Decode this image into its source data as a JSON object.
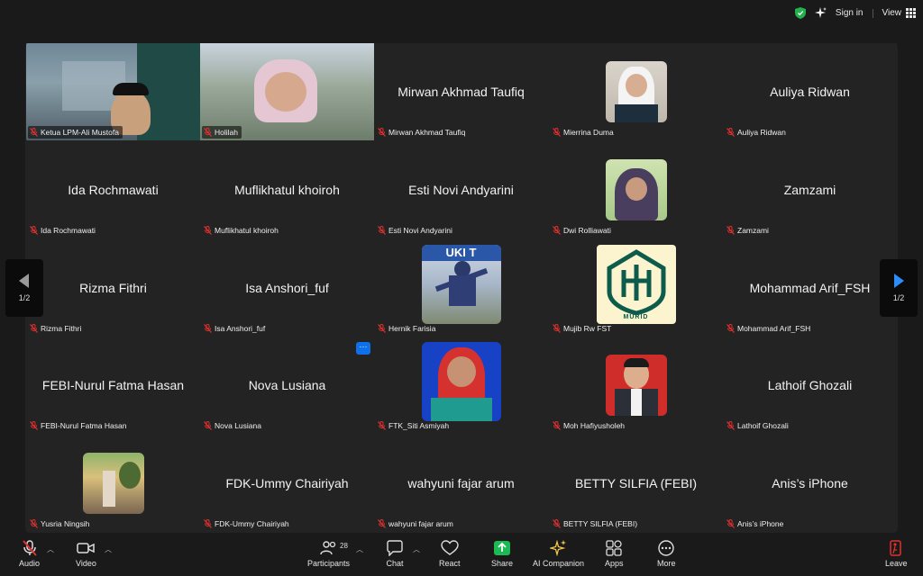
{
  "topbar": {
    "sign_in": "Sign in",
    "view": "View"
  },
  "nav": {
    "page_left": "1/2",
    "page_right": "1/2",
    "more": "···"
  },
  "tiles": [
    {
      "label": "Ketua LPM-Ali Mustofa"
    },
    {
      "label": "Holilah"
    },
    {
      "big": "Mirwan Akhmad Taufiq",
      "label": "Mirwan Akhmad Taufiq"
    },
    {
      "label": "Mierrina Duma"
    },
    {
      "big": "Auliya Ridwan",
      "label": "Auliya Ridwan"
    },
    {
      "big": "Ida Rochmawati",
      "label": "Ida Rochmawati"
    },
    {
      "big": "Muflikhatul khoiroh",
      "label": "Muflikhatul khoiroh"
    },
    {
      "big": "Esti Novi Andyarini",
      "label": "Esti Novi Andyarini"
    },
    {
      "label": "Dwi Rolliawati"
    },
    {
      "big": "Zamzami",
      "label": "Zamzami"
    },
    {
      "big": "Rizma Fithri",
      "label": "Rizma Fithri"
    },
    {
      "big": "Isa Anshori_fuf",
      "label": "Isa Anshori_fuf"
    },
    {
      "label": "Hernik Farisia"
    },
    {
      "label": "Mujib Rw FST"
    },
    {
      "big": "Mohammad Arif_FSH",
      "label": "Mohammad Arif_FSH"
    },
    {
      "big": "FEBI-Nurul Fatma Hasan",
      "label": "FEBI-Nurul Fatma Hasan"
    },
    {
      "big": "Nova Lusiana",
      "label": "Nova Lusiana"
    },
    {
      "label": "FTK_Siti Asmiyah"
    },
    {
      "label": "Moh Hafiyusholeh"
    },
    {
      "big": "Lathoif Ghozali",
      "label": "Lathoif Ghozali"
    },
    {
      "label": "Yusria Ningsih"
    },
    {
      "big": "FDK-Ummy Chairiyah",
      "label": "FDK-Ummy Chairiyah"
    },
    {
      "big": "wahyuni fajar arum",
      "label": "wahyuni fajar arum"
    },
    {
      "big": "BETTY SILFIA (FEBI)",
      "label": "BETTY SILFIA (FEBI)"
    },
    {
      "big": "Anis’s iPhone",
      "label": "Anis’s iPhone"
    }
  ],
  "logo_text": "MURID",
  "toolbar": {
    "audio": "Audio",
    "video": "Video",
    "participants": "Participants",
    "participant_count": "28",
    "chat": "Chat",
    "react": "React",
    "share": "Share",
    "ai": "AI Companion",
    "apps": "Apps",
    "more": "More",
    "leave": "Leave"
  },
  "colors": {
    "active_border": "#3fd04f",
    "mute_red": "#e0312f",
    "share_green": "#1db954"
  }
}
